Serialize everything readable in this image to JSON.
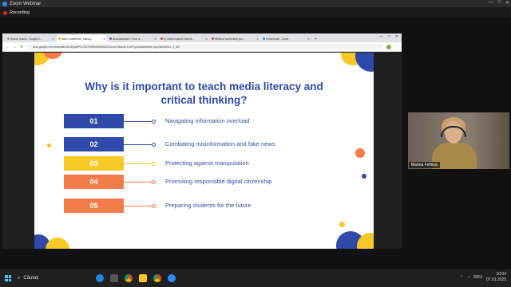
{
  "zoom": {
    "window_title": "Zoom Webinar",
    "recording_label": "Recording",
    "controls": [
      "—",
      "□",
      "✕"
    ]
  },
  "browser": {
    "tabs": [
      {
        "label": "Search results - Google D..."
      },
      {
        "label": "Menc Conference_Manag...",
        "active": true
      },
      {
        "label": "Acesarsbanker » How is ..."
      },
      {
        "label": "K) Disinformation Detecti..."
      },
      {
        "label": "Webinar host invited you..."
      },
      {
        "label": "Presentarier - Zoom"
      }
    ],
    "new_tab": "+",
    "url": "docs.google.com/presentation/d/1EfjuMtPvC39EFbBMMWDkMvUCkwuvk-NBanxtLD1sFKgJoA/edit#slide=id.g2dbc8c6911_0_363"
  },
  "slide": {
    "title_line1": "Why is it important to teach media literacy and",
    "title_line2": "critical thinking?",
    "rows": [
      {
        "num": "01",
        "text": "Navigating information overload",
        "color": "#2f4aa8"
      },
      {
        "num": "02",
        "text": "Combating misinformation and fake news",
        "color": "#2f4aa8"
      },
      {
        "num": "03",
        "text": "Protecting against manipulation",
        "color": "#f6c927"
      },
      {
        "num": "04",
        "text": "Promoting responsible digital citizenship",
        "color": "#f47c4a"
      },
      {
        "num": "05",
        "text": "Preparing students for the future",
        "color": "#f47c4a"
      }
    ]
  },
  "camera": {
    "participant_name": "Marina Felloca"
  },
  "taskbar": {
    "search_label": "Căutați",
    "language": "RDU",
    "time": "10:04",
    "date": "07.01.2025"
  }
}
